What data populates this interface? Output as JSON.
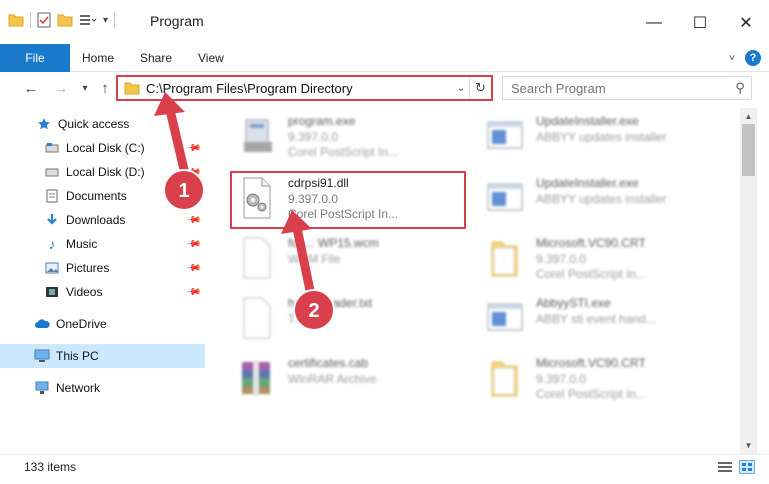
{
  "window": {
    "title": "Program"
  },
  "ribbon": {
    "file": "File",
    "home": "Home",
    "share": "Share",
    "view": "View"
  },
  "address": {
    "path": "C:\\Program Files\\Program Directory"
  },
  "search": {
    "placeholder": "Search Program"
  },
  "sidebar": {
    "items": [
      {
        "label": "Quick access"
      },
      {
        "label": "Local Disk (C:)"
      },
      {
        "label": "Local Disk (D:)"
      },
      {
        "label": "Documents"
      },
      {
        "label": "Downloads"
      },
      {
        "label": "Music"
      },
      {
        "label": "Pictures"
      },
      {
        "label": "Videos"
      },
      {
        "label": "OneDrive"
      },
      {
        "label": "This PC"
      },
      {
        "label": "Network"
      }
    ]
  },
  "files": [
    {
      "name": "program.exe",
      "line1": "9.397.0.0",
      "line2": "Corel PostScript In..."
    },
    {
      "name": "UpdateInstaller.exe",
      "line1": "ABBYY updates installer",
      "line2": ""
    },
    {
      "name": "cdrpsi91.dll",
      "line1": "9.397.0.0",
      "line2": "Corel PostScript In..."
    },
    {
      "name": "UpdateInstaller.exe",
      "line1": "ABBYY updates installer",
      "line2": ""
    },
    {
      "name": "fon... WP15.wcm",
      "line1": "WCM File",
      "line2": ""
    },
    {
      "name": "Microsoft.VC90.CRT",
      "line1": "9.397.0.0",
      "line2": "Corel PostScript In..."
    },
    {
      "name": "hel... Reader.txt",
      "line1": "TXT",
      "line2": ""
    },
    {
      "name": "AbbyySTI.exe",
      "line1": "ABBY sti event hand...",
      "line2": ""
    },
    {
      "name": "certificates.cab",
      "line1": "WinRAR Archive",
      "line2": ""
    },
    {
      "name": "Microsoft.VC90.CRT",
      "line1": "9.397.0.0",
      "line2": "Corel PostScript In..."
    }
  ],
  "status": {
    "count": "133 items"
  },
  "annotations": {
    "badge1": "1",
    "badge2": "2"
  },
  "colors": {
    "accent": "#1979ca",
    "highlight": "#d9404c",
    "selection": "#cce8ff"
  }
}
